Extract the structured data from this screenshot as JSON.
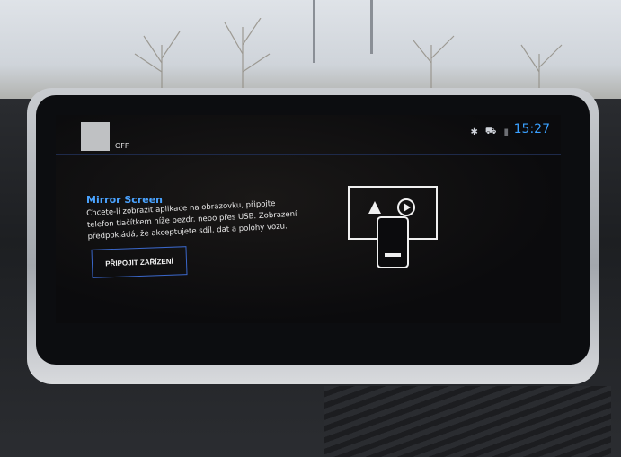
{
  "status": {
    "source_label": "OFF",
    "clock": "15:27",
    "icons": [
      "bluetooth-icon",
      "car-status-icon",
      "signal-icon"
    ]
  },
  "mirror": {
    "title": "Mirror Screen",
    "description": "Chcete-li zobrazit aplikace na obrazovku, připojte telefon tlačítkem níže bezdr. nebo přes USB. Zobrazení předpokládá, že akceptujete sdíl. dat a polohy vozu.",
    "connect_button": "PŘIPOJIT ZAŘÍZENÍ",
    "illustration_icons": [
      "android-auto-icon",
      "carplay-icon",
      "phone-icon"
    ]
  },
  "colors": {
    "accent": "#4aa3ff",
    "button_border": "#3a66c8",
    "screen_bg": "#0b0b0d"
  }
}
